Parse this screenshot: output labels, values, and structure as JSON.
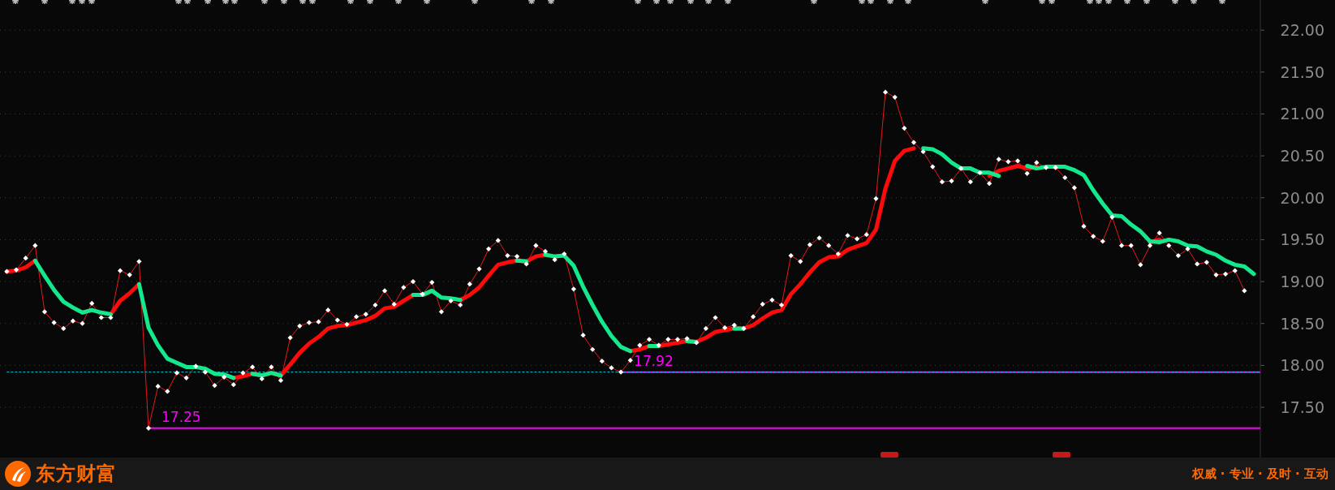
{
  "chart": {
    "chart_data": {
      "type": "line",
      "ylim": [
        16.9,
        22.36
      ],
      "grid": true,
      "yticks": [
        {
          "value": 17.5,
          "label": "17.50"
        },
        {
          "value": 18,
          "label": "18.00"
        },
        {
          "value": 18.5,
          "label": "18.50"
        },
        {
          "value": 19,
          "label": "19.00"
        },
        {
          "value": 19.5,
          "label": "19.50"
        },
        {
          "value": 20,
          "label": "20.00"
        },
        {
          "value": 20.5,
          "label": "20.50"
        },
        {
          "value": 21,
          "label": "21.00"
        },
        {
          "value": 21.5,
          "label": "21.50"
        },
        {
          "value": 22,
          "label": "22.00"
        }
      ],
      "series": [
        {
          "color": "#e81818",
          "marker": "diamond",
          "values": [
            19.12,
            19.14,
            19.28,
            19.43,
            18.64,
            18.51,
            18.44,
            18.53,
            18.5,
            18.74,
            18.57,
            18.57,
            19.13,
            19.08,
            19.24,
            17.25,
            17.75,
            17.69,
            17.91,
            17.85,
            17.99,
            17.92,
            17.76,
            17.86,
            17.77,
            17.91,
            17.98,
            17.84,
            17.98,
            17.82,
            18.33,
            18.47,
            18.51,
            18.52,
            18.66,
            18.54,
            18.49,
            18.58,
            18.61,
            18.72,
            18.89,
            18.73,
            18.93,
            19.0,
            18.85,
            18.99,
            18.64,
            18.77,
            18.72,
            18.97,
            19.15,
            19.39,
            19.49,
            19.31,
            19.3,
            19.21,
            19.43,
            19.36,
            19.26,
            19.33,
            18.91,
            18.36,
            18.19,
            18.05,
            17.97,
            17.92,
            18.06,
            18.24,
            18.31,
            18.24,
            18.31,
            18.31,
            18.32,
            18.27,
            18.44,
            18.57,
            18.45,
            18.48,
            18.44,
            18.58,
            18.73,
            18.78,
            18.72,
            19.31,
            19.24,
            19.44,
            19.52,
            19.43,
            19.33,
            19.55,
            19.51,
            19.56,
            19.99,
            21.26,
            21.2,
            20.83,
            20.66,
            20.55,
            20.37,
            20.19,
            20.2,
            20.35,
            20.19,
            20.3,
            20.17,
            20.46,
            20.43,
            20.44,
            20.29,
            20.42,
            20.36,
            20.36,
            20.24,
            20.12,
            19.66,
            19.54,
            19.48,
            19.77,
            19.43,
            19.43,
            19.2,
            19.43,
            19.58,
            19.43,
            19.31,
            19.39,
            19.21,
            19.23,
            19.08,
            19.09,
            19.13,
            18.89
          ]
        },
        {
          "color": "#ff0a0a",
          "values": [
            19.12,
            19.13,
            19.17,
            19.25,
            null,
            null,
            null,
            null,
            18.63,
            18.66,
            null,
            18.61,
            18.77,
            18.86,
            18.97,
            null,
            null,
            null,
            null,
            null,
            null,
            null,
            null,
            null,
            17.85,
            17.87,
            17.9,
            17.88,
            17.91,
            17.88,
            18.01,
            18.15,
            18.26,
            18.34,
            18.44,
            18.47,
            18.48,
            18.51,
            18.54,
            18.59,
            18.68,
            18.7,
            18.77,
            18.84,
            18.84,
            18.89,
            null,
            null,
            18.78,
            18.84,
            18.93,
            19.07,
            19.2,
            19.23,
            19.25,
            19.24,
            19.3,
            19.32,
            null,
            null,
            null,
            null,
            null,
            null,
            null,
            null,
            18.17,
            18.19,
            18.23,
            18.23,
            18.25,
            18.27,
            18.29,
            18.28,
            18.33,
            18.4,
            18.42,
            18.44,
            18.44,
            18.48,
            18.56,
            18.63,
            18.66,
            18.85,
            18.97,
            19.11,
            19.23,
            19.29,
            19.3,
            19.38,
            19.42,
            19.46,
            19.62,
            20.11,
            20.44,
            20.56,
            20.59,
            null,
            null,
            null,
            null,
            null,
            null,
            null,
            20.26,
            20.32,
            20.35,
            20.38,
            20.35,
            20.37,
            null,
            null,
            null,
            null,
            null,
            null,
            null,
            null,
            null,
            null,
            null,
            19.47,
            19.5,
            null,
            null,
            null,
            null,
            null,
            null,
            null,
            null,
            null
          ]
        },
        {
          "color": "#14e88c",
          "values": [
            null,
            null,
            null,
            19.25,
            19.07,
            18.9,
            18.76,
            18.69,
            18.63,
            18.66,
            18.63,
            18.61,
            null,
            null,
            18.97,
            18.45,
            18.24,
            18.08,
            18.03,
            17.98,
            17.98,
            17.96,
            17.9,
            17.89,
            17.85,
            null,
            17.9,
            17.88,
            17.91,
            17.88,
            null,
            null,
            null,
            null,
            null,
            null,
            null,
            null,
            null,
            null,
            null,
            null,
            null,
            18.84,
            18.84,
            18.89,
            18.81,
            18.8,
            18.78,
            null,
            null,
            null,
            null,
            null,
            19.25,
            19.24,
            null,
            19.32,
            19.3,
            19.31,
            19.19,
            18.94,
            18.72,
            18.52,
            18.35,
            18.22,
            18.17,
            null,
            18.23,
            18.23,
            null,
            null,
            18.29,
            18.28,
            null,
            null,
            null,
            18.44,
            18.44,
            null,
            null,
            null,
            null,
            null,
            null,
            null,
            null,
            null,
            null,
            null,
            null,
            null,
            null,
            null,
            null,
            null,
            null,
            20.59,
            20.58,
            20.52,
            20.42,
            20.35,
            20.35,
            20.3,
            20.3,
            20.26,
            null,
            null,
            20.38,
            20.35,
            20.37,
            20.37,
            20.37,
            20.33,
            20.27,
            20.09,
            19.93,
            19.79,
            19.78,
            19.68,
            19.6,
            19.48,
            19.47,
            19.5,
            19.48,
            19.43,
            19.42,
            19.36,
            19.32,
            19.25,
            19.2,
            19.18,
            19.09
          ]
        }
      ],
      "ref_lines": [
        {
          "axis": "y",
          "value": 17.25,
          "label": "17.25",
          "color": "#ff00ff"
        },
        {
          "axis": "y",
          "value": 17.92,
          "label": "17.92",
          "color": "#ff00ff"
        },
        {
          "axis": "y",
          "value": 17.92,
          "color": "#00c8e0"
        }
      ]
    }
  },
  "footer": {
    "brand": "东方财富",
    "slogan": "权威 · 专业 · 及时 · 互动"
  }
}
